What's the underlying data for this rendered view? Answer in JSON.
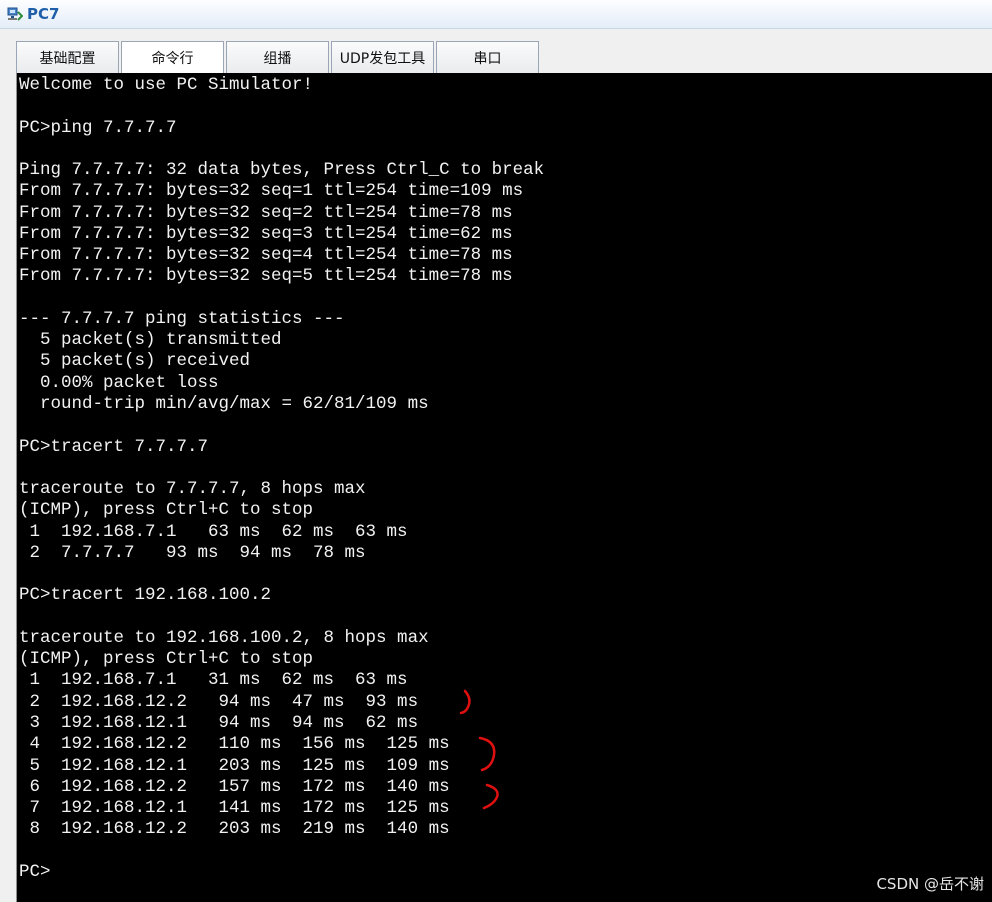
{
  "window": {
    "title": "PC7"
  },
  "tabs": [
    {
      "label": "基础配置"
    },
    {
      "label": "命令行"
    },
    {
      "label": "组播"
    },
    {
      "label": "UDP发包工具"
    },
    {
      "label": "串口"
    }
  ],
  "terminal": {
    "lines": [
      "Welcome to use PC Simulator!",
      "",
      "PC>ping 7.7.7.7",
      "",
      "Ping 7.7.7.7: 32 data bytes, Press Ctrl_C to break",
      "From 7.7.7.7: bytes=32 seq=1 ttl=254 time=109 ms",
      "From 7.7.7.7: bytes=32 seq=2 ttl=254 time=78 ms",
      "From 7.7.7.7: bytes=32 seq=3 ttl=254 time=62 ms",
      "From 7.7.7.7: bytes=32 seq=4 ttl=254 time=78 ms",
      "From 7.7.7.7: bytes=32 seq=5 ttl=254 time=78 ms",
      "",
      "--- 7.7.7.7 ping statistics ---",
      "  5 packet(s) transmitted",
      "  5 packet(s) received",
      "  0.00% packet loss",
      "  round-trip min/avg/max = 62/81/109 ms",
      "",
      "PC>tracert 7.7.7.7",
      "",
      "traceroute to 7.7.7.7, 8 hops max",
      "(ICMP), press Ctrl+C to stop",
      " 1  192.168.7.1   63 ms  62 ms  63 ms",
      " 2  7.7.7.7   93 ms  94 ms  78 ms",
      "",
      "PC>tracert 192.168.100.2",
      "",
      "traceroute to 192.168.100.2, 8 hops max",
      "(ICMP), press Ctrl+C to stop",
      " 1  192.168.7.1   31 ms  62 ms  63 ms",
      " 2  192.168.12.2   94 ms  47 ms  93 ms",
      " 3  192.168.12.1   94 ms  94 ms  62 ms",
      " 4  192.168.12.2   110 ms  156 ms  125 ms",
      " 5  192.168.12.1   203 ms  125 ms  109 ms",
      " 6  192.168.12.2   157 ms  172 ms  140 ms",
      " 7  192.168.12.1   141 ms  172 ms  125 ms",
      " 8  192.168.12.2   203 ms  219 ms  140 ms",
      "",
      "PC>"
    ]
  },
  "watermark": {
    "text": "CSDN @岳不谢"
  },
  "colors": {
    "terminal_bg": "#000000",
    "terminal_text": "#f2f2f2",
    "title_text": "#1f5faa",
    "annotation": "#e01010"
  }
}
